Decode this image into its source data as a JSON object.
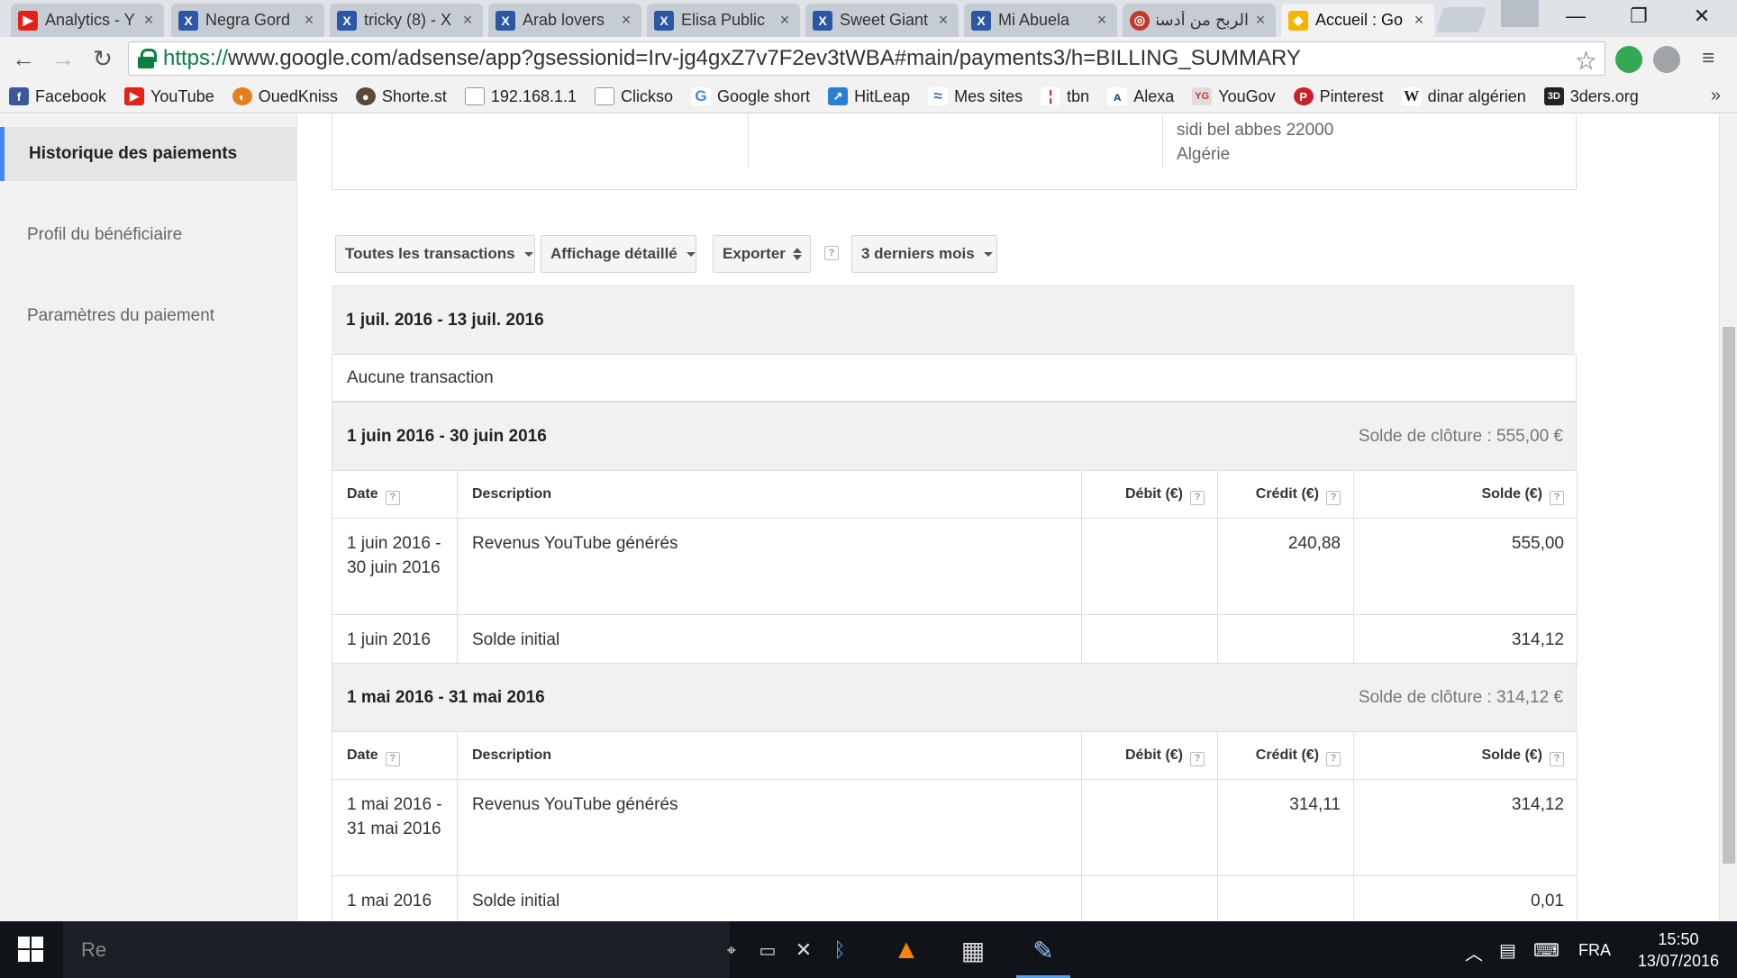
{
  "browser": {
    "tabs": [
      {
        "label": "Analytics - Y",
        "favicon": "youtube-icon",
        "color": "#e62117"
      },
      {
        "label": "Negra Gord",
        "favicon": "x-icon",
        "color": "#2b57a4"
      },
      {
        "label": "tricky (8) - X",
        "favicon": "x-icon",
        "color": "#2b57a4"
      },
      {
        "label": "Arab lovers",
        "favicon": "x-icon",
        "color": "#2b57a4"
      },
      {
        "label": "Elisa Public",
        "favicon": "x-icon",
        "color": "#2b57a4"
      },
      {
        "label": "Sweet Giant",
        "favicon": "x-icon",
        "color": "#2b57a4"
      },
      {
        "label": "Mi Abuela",
        "favicon": "x-icon",
        "color": "#2b57a4"
      },
      {
        "label": "الربح من أدسنس",
        "favicon": "globe-icon",
        "color": "#c0392b"
      },
      {
        "label": "Accueil : Go",
        "favicon": "adsense-icon",
        "color": "#f4b400",
        "active": true
      }
    ],
    "url": {
      "scheme": "https://",
      "rest": "www.google.com/adsense/app?gsessionid=Irv-jg4gxZ7v7F2ev3tWBA#main/payments3/h=BILLING_SUMMARY"
    },
    "bookmarks": [
      {
        "label": "Facebook",
        "icon": "facebook-icon",
        "color": "#3b5998",
        "glyph": "f"
      },
      {
        "label": "YouTube",
        "icon": "youtube-icon",
        "color": "#e62117",
        "glyph": "▶"
      },
      {
        "label": "OuedKniss",
        "icon": "ouedkniss-icon",
        "color": "#e67e22",
        "glyph": "◐"
      },
      {
        "label": "Shorte.st",
        "icon": "shortest-icon",
        "color": "#5b4a3a",
        "glyph": "●"
      },
      {
        "label": "192.168.1.1",
        "icon": "page-icon",
        "color": "#9e9e9e",
        "glyph": "▯"
      },
      {
        "label": "Clickso",
        "icon": "page-icon",
        "color": "#9e9e9e",
        "glyph": "▯"
      },
      {
        "label": "Google short",
        "icon": "google-icon",
        "color": "#4285f4",
        "glyph": "G"
      },
      {
        "label": "HitLeap",
        "icon": "hitleap-icon",
        "color": "#2a7fd4",
        "glyph": "↗"
      },
      {
        "label": "Mes sites",
        "icon": "mes-sites-icon",
        "color": "#3f6cb5",
        "glyph": "≈"
      },
      {
        "label": "tbn",
        "icon": "tbn-icon",
        "color": "#c0392b",
        "glyph": "¦"
      },
      {
        "label": "Alexa",
        "icon": "alexa-icon",
        "color": "#1e4e8c",
        "glyph": "A"
      },
      {
        "label": "YouGov",
        "icon": "yougov-icon",
        "color": "#cccccc",
        "glyph": "Y"
      },
      {
        "label": "Pinterest",
        "icon": "pinterest-icon",
        "color": "#cb2027",
        "glyph": "P"
      },
      {
        "label": "dinar algérien",
        "icon": "wikipedia-icon",
        "color": "#ffffff",
        "glyph": "W"
      },
      {
        "label": "3ders.org",
        "icon": "3ders-icon",
        "color": "#222222",
        "glyph": "3D"
      }
    ]
  },
  "sidebar": {
    "items": [
      {
        "label": "Historique des paiements",
        "active": true
      },
      {
        "label": "Profil du bénéficiaire"
      },
      {
        "label": "Paramètres du paiement"
      }
    ]
  },
  "address": {
    "line1": "sidi bel abbes 22000",
    "line2": "Algérie"
  },
  "filters": {
    "transactions": "Toutes les transactions",
    "view": "Affichage détaillé",
    "export": "Exporter",
    "help": "?",
    "range": "3 derniers mois"
  },
  "columns": {
    "date": "Date",
    "description": "Description",
    "debit": "Débit (€)",
    "credit": "Crédit (€)",
    "balance": "Solde (€)"
  },
  "periods": [
    {
      "title": "1 juil. 2016 - 13 juil. 2016",
      "closing": "",
      "empty": "Aucune transaction"
    },
    {
      "title": "1 juin 2016 - 30 juin 2016",
      "closing": "Solde de clôture : 555,00 €",
      "rows": [
        {
          "date": "1 juin 2016 - 30 juin 2016",
          "description": "Revenus YouTube générés",
          "debit": "",
          "credit": "240,88",
          "balance": "555,00"
        },
        {
          "date": "1 juin 2016",
          "description": "Solde initial",
          "debit": "",
          "credit": "",
          "balance": "314,12"
        }
      ]
    },
    {
      "title": "1 mai 2016 - 31 mai 2016",
      "closing": "Solde de clôture : 314,12 €",
      "rows": [
        {
          "date": "1 mai 2016 - 31 mai 2016",
          "description": "Revenus YouTube générés",
          "debit": "",
          "credit": "314,11",
          "balance": "314,12"
        },
        {
          "date": "1 mai 2016",
          "description": "Solde initial",
          "debit": "",
          "credit": "",
          "balance": "0,01"
        }
      ]
    }
  ],
  "taskbar": {
    "search_placeholder": "Re",
    "language": "FRA",
    "time": "15:50",
    "date": "13/07/2016"
  }
}
